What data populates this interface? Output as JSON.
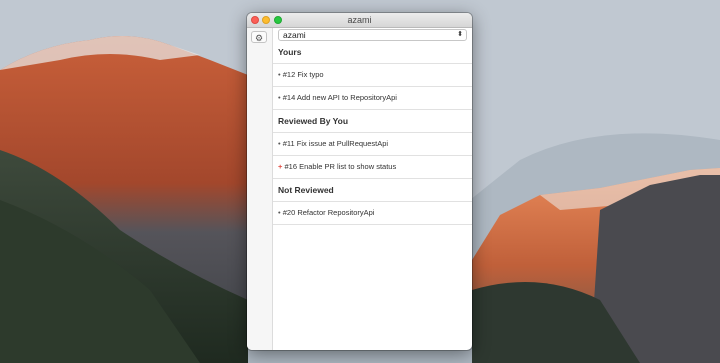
{
  "window": {
    "title": "azami"
  },
  "repo_select": {
    "value": "azami"
  },
  "sections": [
    {
      "header": "Yours",
      "items": [
        {
          "bullet": "•",
          "text": "#12 Fix typo"
        },
        {
          "bullet": "•",
          "text": "#14 Add new API to RepositoryApi"
        }
      ]
    },
    {
      "header": "Reviewed By You",
      "items": [
        {
          "bullet": "•",
          "text": "#11 Fix issue at PullRequestApi"
        },
        {
          "bullet": "+",
          "text": "#16 Enable PR list to show status"
        }
      ]
    },
    {
      "header": "Not Reviewed",
      "items": [
        {
          "bullet": "•",
          "text": "#20 Refactor RepositoryApi"
        }
      ]
    }
  ],
  "icons": {
    "settings": "gear-icon",
    "select_arrows": "updown-chevron-icon"
  },
  "colors": {
    "close": "#fc5f57",
    "minimize": "#fdbc2e",
    "maximize": "#28c840",
    "plus_bullet": "#e0443a"
  }
}
